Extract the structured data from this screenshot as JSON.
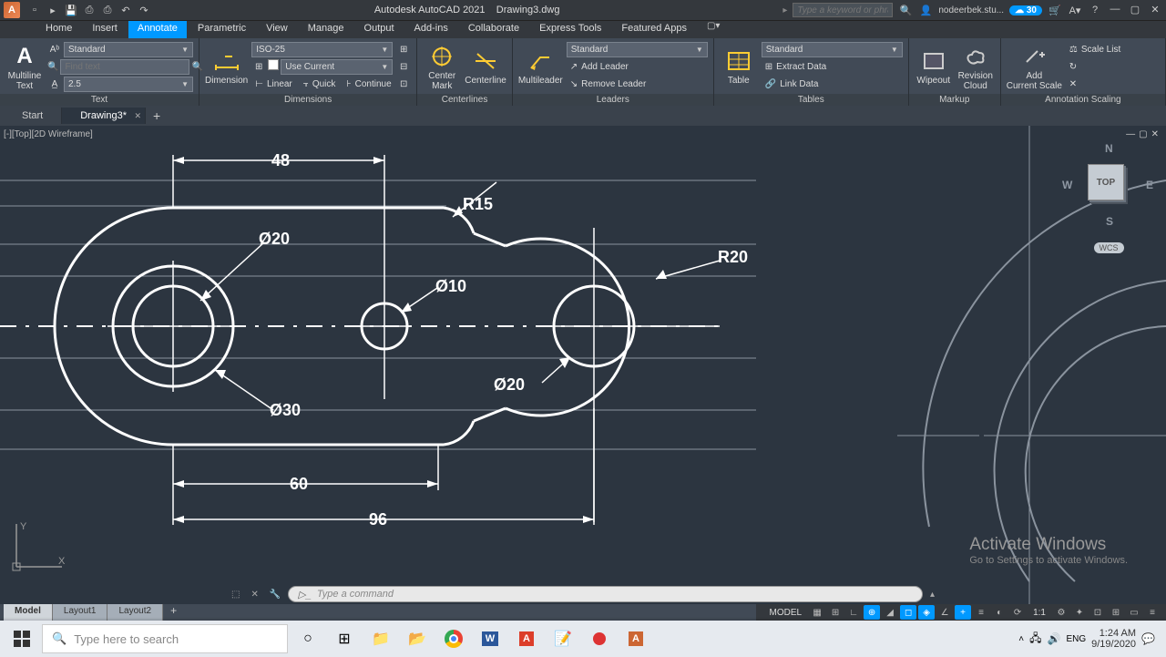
{
  "title": {
    "app": "Autodesk AutoCAD 2021",
    "file": "Drawing3.dwg"
  },
  "search_placeholder": "Type a keyword or phrase",
  "user_name": "nodeerbek.stu...",
  "cloud_badge": "30",
  "menu": {
    "items": [
      "Home",
      "Insert",
      "Annotate",
      "Parametric",
      "View",
      "Manage",
      "Output",
      "Add-ins",
      "Collaborate",
      "Express Tools",
      "Featured Apps"
    ],
    "active": "Annotate"
  },
  "ribbon": {
    "text_panel": {
      "big": "Multiline\nText",
      "style": "Standard",
      "find_placeholder": "Find text",
      "height": "2.5",
      "label": "Text"
    },
    "dim_panel": {
      "big": "Dimension",
      "style": "ISO-25",
      "layer_label": "Use Current",
      "linear": "Linear",
      "quick": "Quick",
      "continue": "Continue",
      "label": "Dimensions"
    },
    "center_panel": {
      "a": "Center\nMark",
      "b": "Centerline",
      "label": "Centerlines"
    },
    "leader_panel": {
      "big": "Multileader",
      "style": "Standard",
      "add": "Add Leader",
      "remove": "Remove Leader",
      "label": "Leaders"
    },
    "table_panel": {
      "big": "Table",
      "style": "Standard",
      "extract": "Extract Data",
      "link": "Link Data",
      "label": "Tables"
    },
    "markup_panel": {
      "a": "Wipeout",
      "b": "Revision\nCloud",
      "label": "Markup"
    },
    "scale_panel": {
      "add": "Add\nCurrent Scale",
      "list": "Scale List",
      "label": "Annotation Scaling"
    }
  },
  "file_tabs": {
    "start": "Start",
    "active": "Drawing3*"
  },
  "viewport": {
    "label": "[-][Top][2D Wireframe]",
    "cube": "TOP",
    "wcs": "WCS",
    "dirs": {
      "n": "N",
      "s": "S",
      "e": "E",
      "w": "W"
    }
  },
  "ucs": {
    "x": "X",
    "y": "Y"
  },
  "watermark": {
    "l1": "Activate Windows",
    "l2": "Go to Settings to activate Windows."
  },
  "cmd_placeholder": "Type a command",
  "layout_tabs": [
    "Model",
    "Layout1",
    "Layout2"
  ],
  "status": {
    "model": "MODEL",
    "ratio": "1:1"
  },
  "taskbar": {
    "search": "Type here to search",
    "time": "1:24 AM",
    "date": "9/19/2020"
  },
  "chart_data": {
    "type": "table",
    "title": "Dimensions",
    "series": [
      {
        "name": "linear_top",
        "value": 48
      },
      {
        "name": "linear_bottom_inner",
        "value": 60
      },
      {
        "name": "linear_bottom_full",
        "value": 96
      },
      {
        "name": "diameter_left_outer",
        "value": 30
      },
      {
        "name": "diameter_left_inner",
        "value": 20
      },
      {
        "name": "diameter_mid",
        "value": 10
      },
      {
        "name": "diameter_right",
        "value": 20
      },
      {
        "name": "radius_top_fillet",
        "value": 15
      },
      {
        "name": "radius_right_end",
        "value": 20
      }
    ],
    "labels": {
      "d48": "48",
      "d60": "60",
      "d96": "96",
      "d30": "Ø30",
      "d20a": "Ø20",
      "d10": "Ø10",
      "d20b": "Ø20",
      "r15": "R15",
      "r20": "R20"
    }
  }
}
